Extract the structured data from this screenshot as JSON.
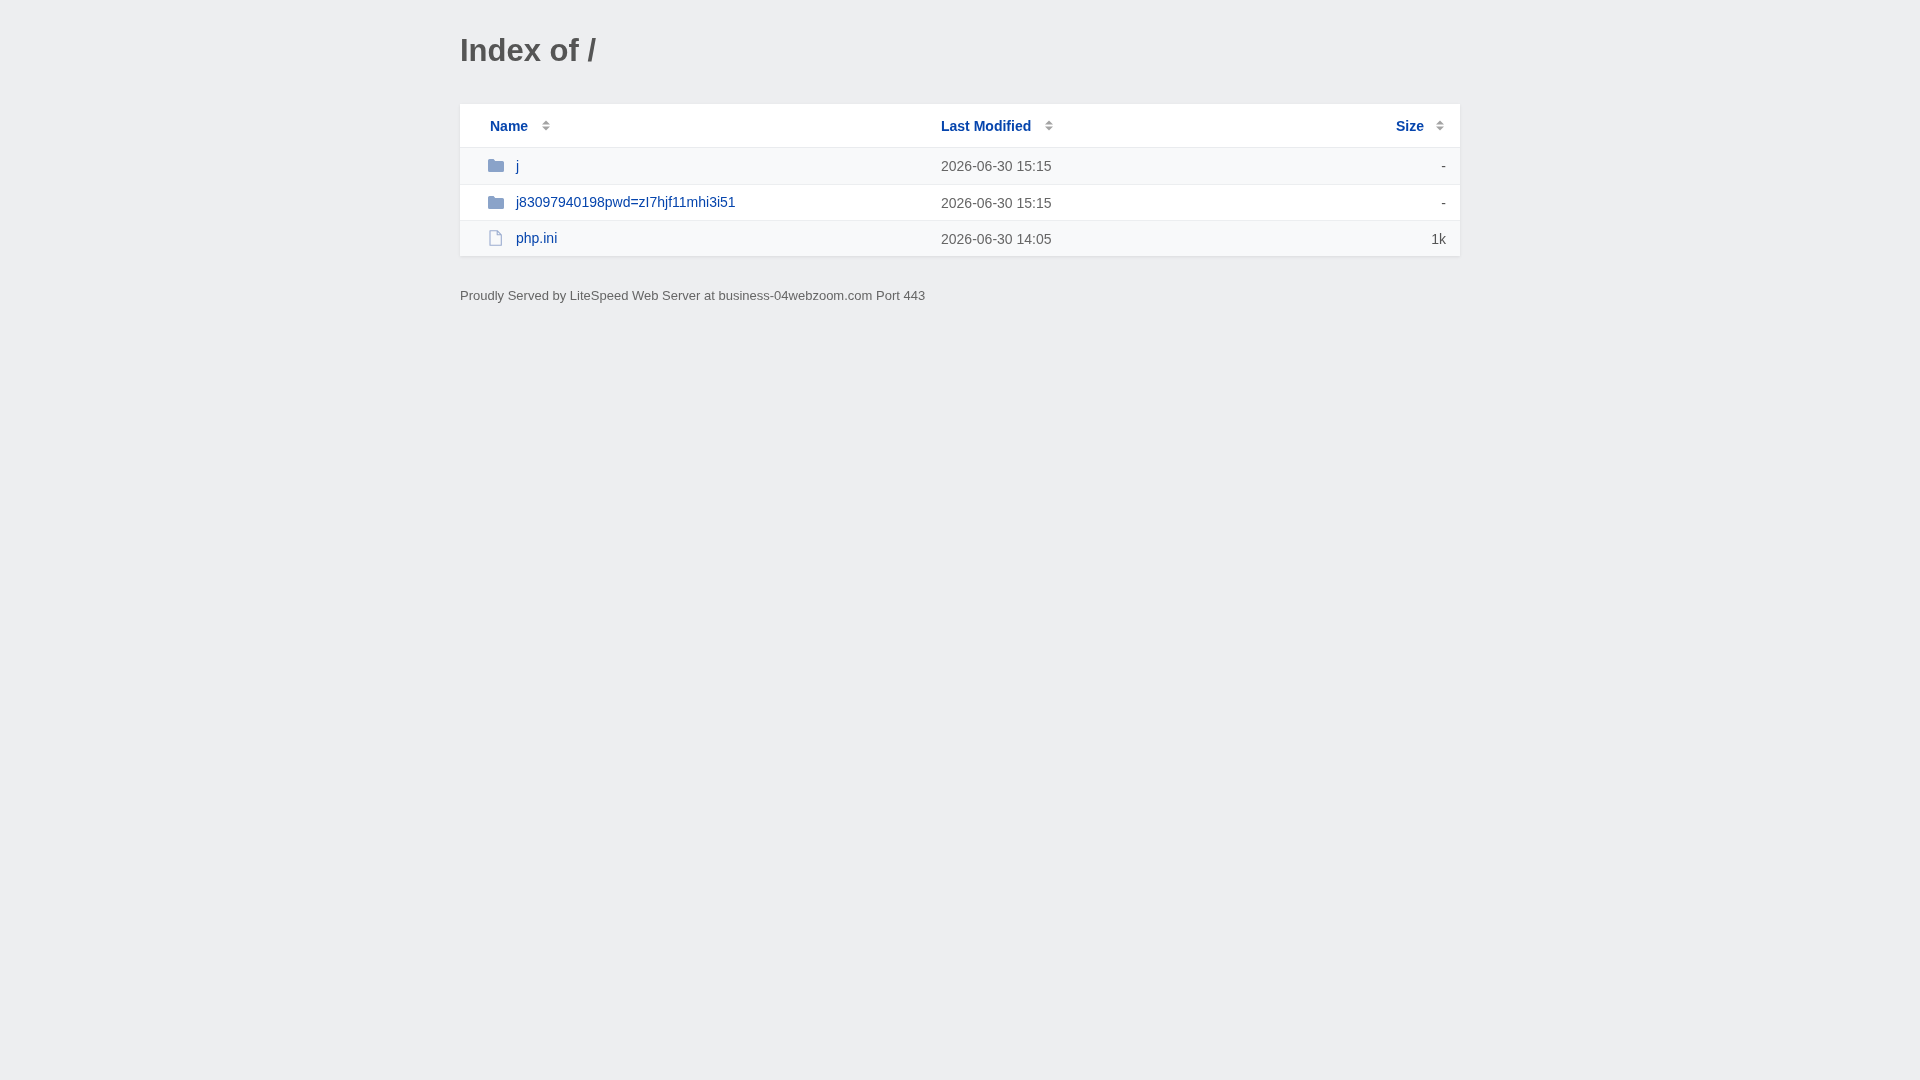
{
  "title": "Index of /",
  "table": {
    "columns": [
      {
        "label": "Name"
      },
      {
        "label": "Last Modified"
      },
      {
        "label": "Size"
      }
    ],
    "rows": [
      {
        "kind": "folder",
        "name": "j",
        "modified": "2026-06-30 15:15",
        "size": "-"
      },
      {
        "kind": "folder",
        "name": "j83097940198pwd=zI7hjf11mhi3i51",
        "modified": "2026-06-30 15:15",
        "size": "-"
      },
      {
        "kind": "file",
        "name": "php.ini",
        "modified": "2026-06-30 14:05",
        "size": "1k"
      }
    ]
  },
  "footer": "Proudly Served by LiteSpeed Web Server at business-04webzoom.com Port 443"
}
